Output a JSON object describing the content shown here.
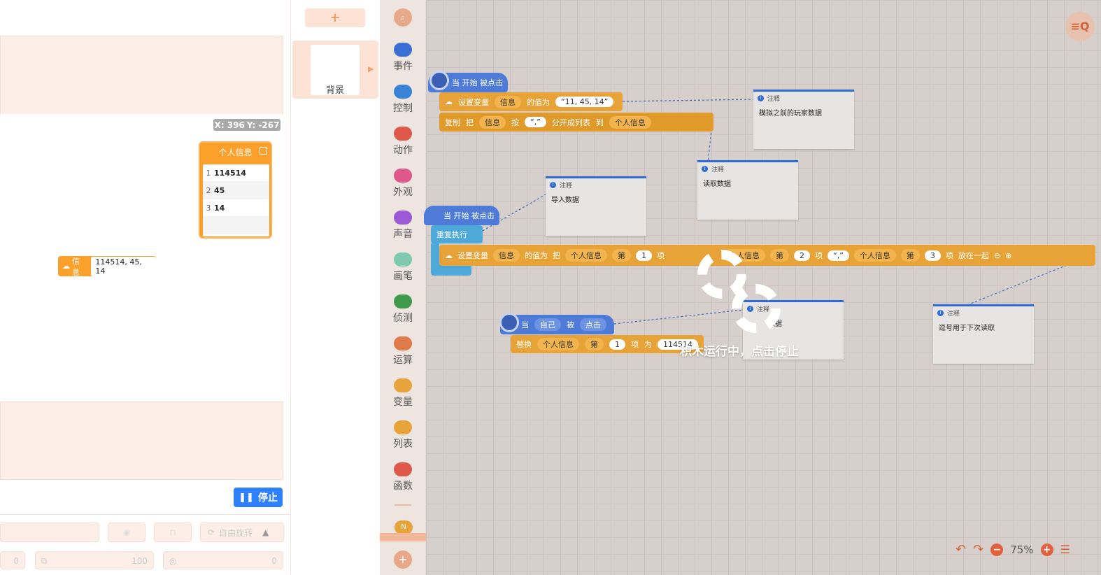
{
  "stage": {
    "coords": {
      "x": "X: 396",
      "y": "Y: -267"
    },
    "list_monitor": {
      "title": "个人信息",
      "items": [
        {
          "n": "1",
          "v": "114514"
        },
        {
          "n": "2",
          "v": "45"
        },
        {
          "n": "3",
          "v": "14"
        }
      ]
    },
    "var_monitor": {
      "label": "信息",
      "value": "114514, 45, 14"
    },
    "stop_label": "停止",
    "controls": {
      "rotate_label": "自由旋转",
      "x_val": "0",
      "size_val": "100",
      "dir_val": "0"
    }
  },
  "sprites": {
    "add": "+",
    "background_label": "背景"
  },
  "categories": [
    {
      "label": "事件",
      "color": "#3b6fd6",
      "icon": "toggle-icon"
    },
    {
      "label": "控制",
      "color": "#3b83d8",
      "icon": "gamepad-icon"
    },
    {
      "label": "动作",
      "color": "#e0584a",
      "icon": "robot-icon"
    },
    {
      "label": "外观",
      "color": "#e0588a",
      "icon": "shirt-icon"
    },
    {
      "label": "声音",
      "color": "#9c5ad6",
      "icon": "music-icon"
    },
    {
      "label": "画笔",
      "color": "#7fc9b0",
      "icon": "pen-icon"
    },
    {
      "label": "侦测",
      "color": "#3f9a4b",
      "icon": "target-icon"
    },
    {
      "label": "运算",
      "color": "#e07a4a",
      "icon": "percent-icon"
    },
    {
      "label": "变量",
      "color": "#e8a43a",
      "icon": "braces-icon"
    },
    {
      "label": "列表",
      "color": "#e8a43a",
      "icon": "list-icon"
    },
    {
      "label": "函数",
      "color": "#e0584a",
      "icon": "fx-icon"
    }
  ],
  "blocks": {
    "hat1": "当 开始 被点击",
    "set1": {
      "label": "设置变量",
      "var": "信息",
      "mid": "的值为",
      "value": "“11, 45, 14”"
    },
    "split": {
      "label": "复制",
      "b": "把",
      "var": "信息",
      "by": "按",
      "sep": "“,”",
      "op": "分开成列表",
      "to": "到",
      "list": "个人信息"
    },
    "hat2": "当 开始 被点击",
    "repeat": "重复执行",
    "set2": {
      "label": "设置变量",
      "var": "信息",
      "mid": "的值为",
      "b": "把",
      "list": "个人信息",
      "di": "第",
      "n1": "1",
      "xiang": "项",
      "n2": "2",
      "sep": "“,”",
      "n3": "3",
      "join": "放在一起"
    },
    "hat3": {
      "when": "当",
      "self": "自己",
      "by": "被",
      "click": "点击"
    },
    "replace": {
      "label": "替换",
      "list": "个人信息",
      "di": "第",
      "n": "1",
      "xiang": "项",
      "wei": "为",
      "value": "114514"
    }
  },
  "notes": [
    {
      "head": "注释",
      "body": "模拟之前的玩家数据"
    },
    {
      "head": "注释",
      "body": "读取数据"
    },
    {
      "head": "注释",
      "body": "导入数据"
    },
    {
      "head": "注释",
      "body": "数据"
    },
    {
      "head": "注释",
      "body": "逗号用于下次读取"
    }
  ],
  "running_message": "积木运行中，点击停止",
  "zoom": "75%"
}
